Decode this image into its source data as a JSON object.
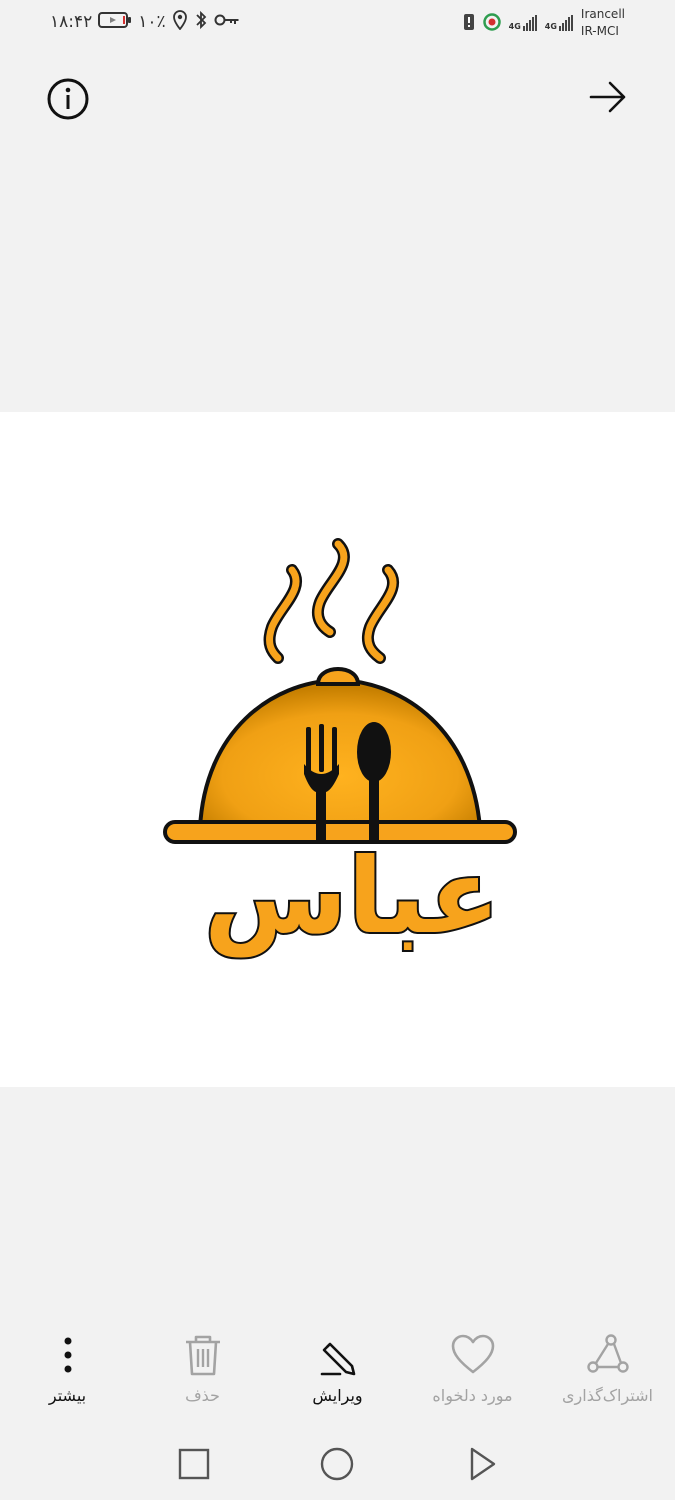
{
  "status_bar": {
    "time": "۱۸:۴۲",
    "battery_percent": "۱۰٪",
    "battery_level": 0.1,
    "network_tags": [
      "4G",
      "4G"
    ],
    "carriers": [
      "Irancell",
      "IR-MCI"
    ],
    "icons": [
      "battery-icon",
      "location-icon",
      "bluetooth-icon",
      "vpn-key-icon",
      "alert-icon",
      "app-notification-icon",
      "signal-icon"
    ]
  },
  "top_bar": {
    "icons": [
      "info-icon",
      "arrow-right-icon"
    ]
  },
  "image": {
    "logo_text": "عباس",
    "colors": {
      "gold": "#f7a31c",
      "gold_dark": "#d98a00",
      "outline": "#111111",
      "steam": "#f7a31c"
    }
  },
  "actions": [
    {
      "label": "اشتراک‌گذاری",
      "icon": "share-icon",
      "enabled": false
    },
    {
      "label": "مورد دلخواه",
      "icon": "heart-icon",
      "enabled": false
    },
    {
      "label": "ویرایش",
      "icon": "edit-icon",
      "enabled": true
    },
    {
      "label": "حذف",
      "icon": "trash-icon",
      "enabled": false
    },
    {
      "label": "بیشتر",
      "icon": "more-icon",
      "enabled": true
    }
  ],
  "nav_bar": {
    "icons": [
      "recents-square-icon",
      "home-circle-icon",
      "back-triangle-icon"
    ]
  }
}
